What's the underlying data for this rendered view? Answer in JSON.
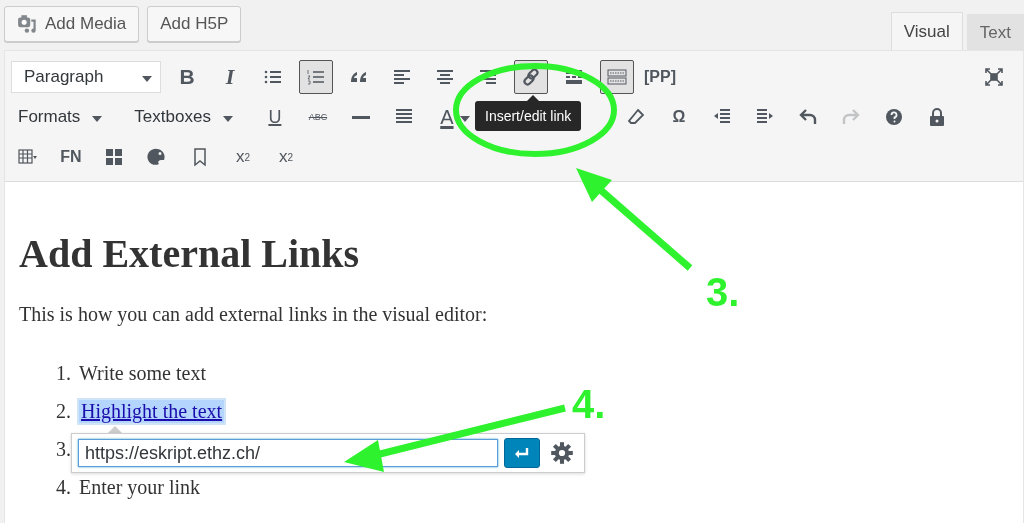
{
  "media_buttons": [
    {
      "kind": "media",
      "label": "Add Media"
    },
    {
      "kind": "plain",
      "label": "Add H5P"
    }
  ],
  "tabs": [
    {
      "label": "Visual",
      "selected": true
    },
    {
      "label": "Text",
      "selected": false
    }
  ],
  "toolbar_rows": [
    {
      "items": [
        {
          "kind": "select",
          "label": "Paragraph",
          "pressed": false,
          "disabled": false
        },
        {
          "kind": "bold",
          "label": "B",
          "pressed": false,
          "disabled": false
        },
        {
          "kind": "italic",
          "label": "I",
          "pressed": false,
          "disabled": false
        },
        {
          "kind": "bullets",
          "pressed": false,
          "disabled": false
        },
        {
          "kind": "numbered",
          "pressed": true,
          "disabled": false
        },
        {
          "kind": "quote",
          "pressed": false,
          "disabled": false
        },
        {
          "kind": "alignleft",
          "pressed": false,
          "disabled": false
        },
        {
          "kind": "aligncenter",
          "pressed": false,
          "disabled": false
        },
        {
          "kind": "alignright",
          "pressed": false,
          "disabled": false
        },
        {
          "kind": "link",
          "pressed": true,
          "disabled": false
        },
        {
          "kind": "more",
          "pressed": false,
          "disabled": false
        },
        {
          "kind": "keyboard",
          "pressed": true,
          "disabled": false
        },
        {
          "kind": "word",
          "label": "[PP]",
          "pressed": false,
          "disabled": false
        },
        {
          "kind": "fullscreen",
          "pressed": false,
          "disabled": false
        }
      ]
    },
    {
      "items": [
        {
          "kind": "menu",
          "label": "Formats",
          "pressed": false,
          "disabled": false
        },
        {
          "kind": "menu",
          "label": "Textboxes",
          "pressed": false,
          "disabled": false
        },
        {
          "kind": "underline",
          "label": "U",
          "pressed": false,
          "disabled": false
        },
        {
          "kind": "strike",
          "label": "ABC",
          "pressed": false,
          "disabled": false
        },
        {
          "kind": "hr",
          "pressed": false,
          "disabled": false
        },
        {
          "kind": "justify",
          "pressed": false,
          "disabled": false
        },
        {
          "kind": "textcolor",
          "label": "A",
          "pressed": false,
          "disabled": false
        },
        {
          "kind": "hidden"
        },
        {
          "kind": "hidden"
        },
        {
          "kind": "eraser",
          "pressed": false,
          "disabled": false
        },
        {
          "kind": "word",
          "label": "Ω",
          "pressed": false,
          "disabled": false
        },
        {
          "kind": "outdent",
          "pressed": false,
          "disabled": false
        },
        {
          "kind": "indent",
          "pressed": false,
          "disabled": false
        },
        {
          "kind": "undo",
          "pressed": false,
          "disabled": false
        },
        {
          "kind": "redo",
          "pressed": false,
          "disabled": true
        },
        {
          "kind": "help",
          "pressed": false,
          "disabled": false
        },
        {
          "kind": "lock",
          "pressed": false,
          "disabled": false
        }
      ]
    },
    {
      "items": [
        {
          "kind": "table",
          "pressed": false,
          "disabled": false
        },
        {
          "kind": "word",
          "label": "FN",
          "pressed": false,
          "disabled": false
        },
        {
          "kind": "blocks",
          "pressed": false,
          "disabled": false
        },
        {
          "kind": "palette",
          "pressed": false,
          "disabled": false
        },
        {
          "kind": "bookmark",
          "pressed": false,
          "disabled": false
        },
        {
          "kind": "superscript",
          "label": "x",
          "mark": "2",
          "pressed": false,
          "disabled": false
        },
        {
          "kind": "subscript",
          "label": "x",
          "mark": "2",
          "pressed": false,
          "disabled": false
        }
      ]
    }
  ],
  "tooltip": "Insert/edit link",
  "content": {
    "heading": "Add External Links",
    "paragraph": "This is how you can add external links in the visual editor:",
    "list": [
      {
        "number": "1.",
        "text": "Write some text",
        "linked": false
      },
      {
        "number": "2.",
        "text": "Highlight the text",
        "linked": true
      },
      {
        "number": "3."
      },
      {
        "number": "4.",
        "text": "Enter your link",
        "linked": false
      }
    ]
  },
  "link_popup": {
    "value": "https://eskript.ethz.ch/"
  },
  "annotations": [
    {
      "label": "3."
    },
    {
      "label": "4."
    }
  ]
}
